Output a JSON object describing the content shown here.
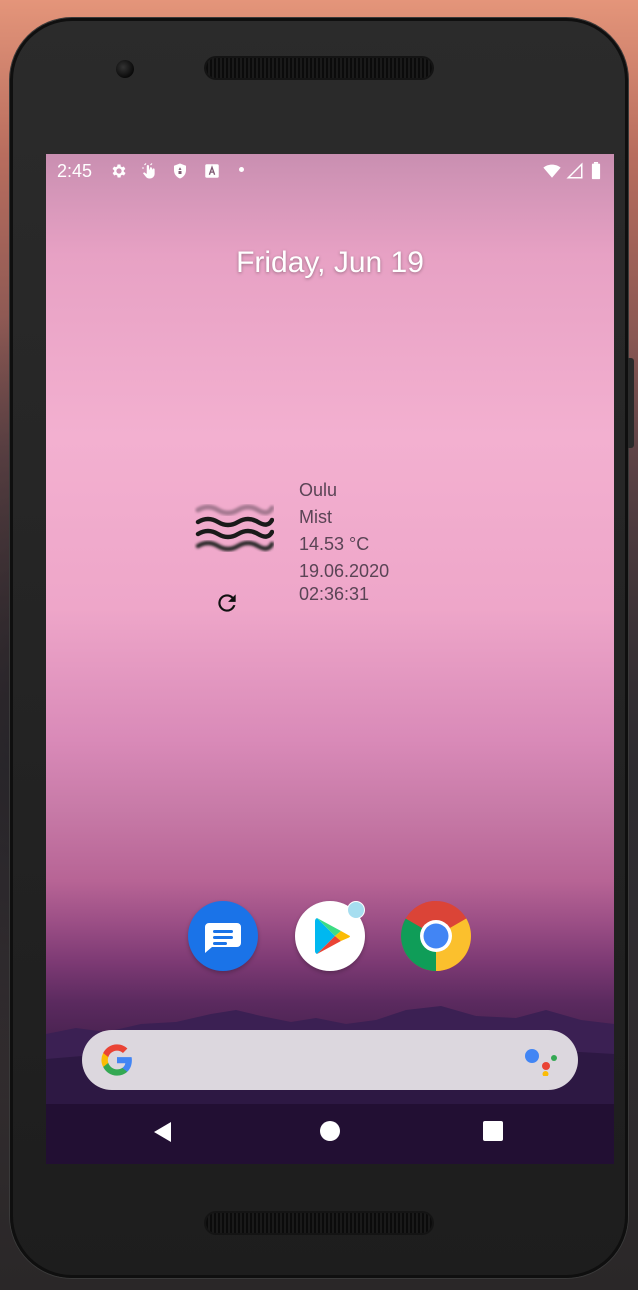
{
  "status_bar": {
    "time": "2:45",
    "left_icons": [
      "settings-icon",
      "touch-icon",
      "shield-icon",
      "a-icon",
      "dot"
    ],
    "right_icons": [
      "wifi-icon",
      "signal-icon",
      "battery-icon"
    ]
  },
  "home": {
    "date": "Friday, Jun 19"
  },
  "weather_widget": {
    "city": "Oulu",
    "condition": "Mist",
    "temperature": "14.53 °C",
    "date": "19.06.2020",
    "time": "02:36:31",
    "condition_icon": "mist-icon",
    "refresh_icon": "refresh-icon"
  },
  "dock": {
    "apps": [
      {
        "name": "Messages",
        "icon": "messages-icon",
        "color": "#1a73e8"
      },
      {
        "name": "Play Store",
        "icon": "play-store-icon",
        "badge": true
      },
      {
        "name": "Chrome",
        "icon": "chrome-icon"
      }
    ]
  },
  "search": {
    "left_icon": "google-g-icon",
    "right_icon": "google-assistant-icon"
  },
  "nav_bar": {
    "buttons": [
      "back",
      "home",
      "recents"
    ]
  },
  "colors": {
    "weather_text": "#5a4455",
    "search_bg": "#dcd7de"
  }
}
